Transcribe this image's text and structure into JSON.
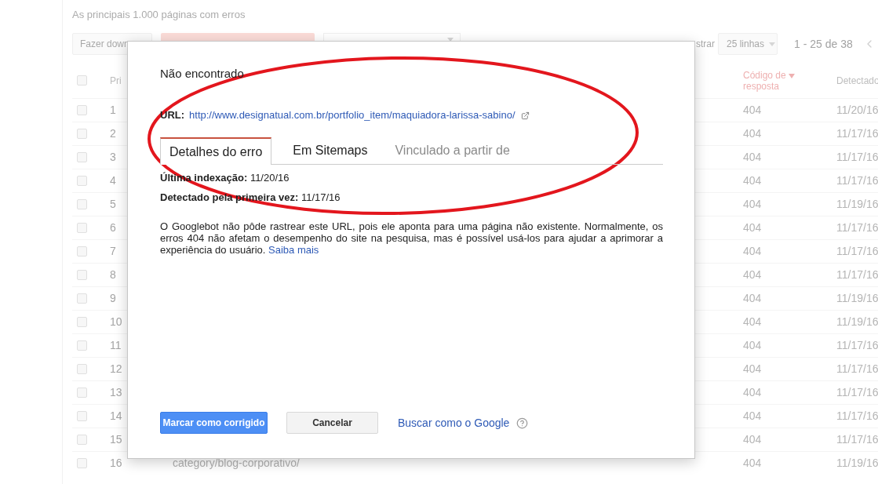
{
  "page": {
    "heading": "As principais 1.000 páginas com erros"
  },
  "toolbar": {
    "download_button": "Fazer down",
    "show_label": "strar",
    "rows_dropdown": "25 linhas",
    "pagination": "1 - 25 de 38"
  },
  "table": {
    "select_all": {
      "checked": false
    },
    "columns": [
      {
        "label": "Pri",
        "sorted": false
      },
      {
        "label": "Código de resposta",
        "sorted": true
      },
      {
        "label": "Detectado",
        "sorted": false
      }
    ],
    "rows": [
      {
        "number": "1",
        "checked": false,
        "code": "404",
        "detected": "11/20/16"
      },
      {
        "number": "2",
        "checked": false,
        "code": "404",
        "detected": "11/17/16"
      },
      {
        "number": "3",
        "checked": false,
        "code": "404",
        "detected": "11/17/16"
      },
      {
        "number": "4",
        "checked": false,
        "code": "404",
        "detected": "11/17/16"
      },
      {
        "number": "5",
        "checked": false,
        "code": "404",
        "detected": "11/19/16"
      },
      {
        "number": "6",
        "checked": false,
        "code": "404",
        "detected": "11/17/16"
      },
      {
        "number": "7",
        "checked": false,
        "code": "404",
        "detected": "11/17/16"
      },
      {
        "number": "8",
        "checked": false,
        "code": "404",
        "detected": "11/17/16"
      },
      {
        "number": "9",
        "checked": false,
        "code": "404",
        "detected": "11/19/16"
      },
      {
        "number": "10",
        "checked": false,
        "code": "404",
        "detected": "11/19/16"
      },
      {
        "number": "11",
        "checked": false,
        "code": "404",
        "detected": "11/17/16"
      },
      {
        "number": "12",
        "checked": false,
        "code": "404",
        "detected": "11/17/16"
      },
      {
        "number": "13",
        "checked": false,
        "code": "404",
        "detected": "11/17/16"
      },
      {
        "number": "14",
        "checked": false,
        "code": "404",
        "detected": "11/17/16"
      },
      {
        "number": "15",
        "checked": false,
        "code": "404",
        "detected": "11/17/16"
      },
      {
        "number": "16",
        "checked": false,
        "url": "category/blog-corporativo/",
        "code": "404",
        "detected": "11/19/16"
      }
    ]
  },
  "dialog": {
    "title": "Não encontrado",
    "url_label": "URL:",
    "url": "http://www.designatual.com.br/portfolio_item/maquiadora-larissa-sabino/",
    "tabs": [
      {
        "label": "Detalhes do erro",
        "selected": true,
        "disabled": false
      },
      {
        "label": "Em Sitemaps",
        "selected": false,
        "disabled": false
      },
      {
        "label": "Vinculado a partir de",
        "selected": false,
        "disabled": true
      }
    ],
    "details": [
      "**Última indexação:** 11/20/16",
      "**Detectado pela primeira vez:** 11/17/16"
    ],
    "description": "O Googlebot não pôde rastrear este URL, pois ele aponta para uma página não existente. Normalmente, os erros 404 não afetam o desempenho do site na pesquisa, mas é possível usá-los para ajudar a aprimorar a experiência do usuário.",
    "learn_more": "Saiba mais",
    "buttons": [
      {
        "label": "Marcar como corrigido",
        "kind": "primary"
      },
      {
        "label": "Cancelar",
        "kind": "secondary"
      }
    ],
    "fetch_link": "Buscar como o Google"
  }
}
